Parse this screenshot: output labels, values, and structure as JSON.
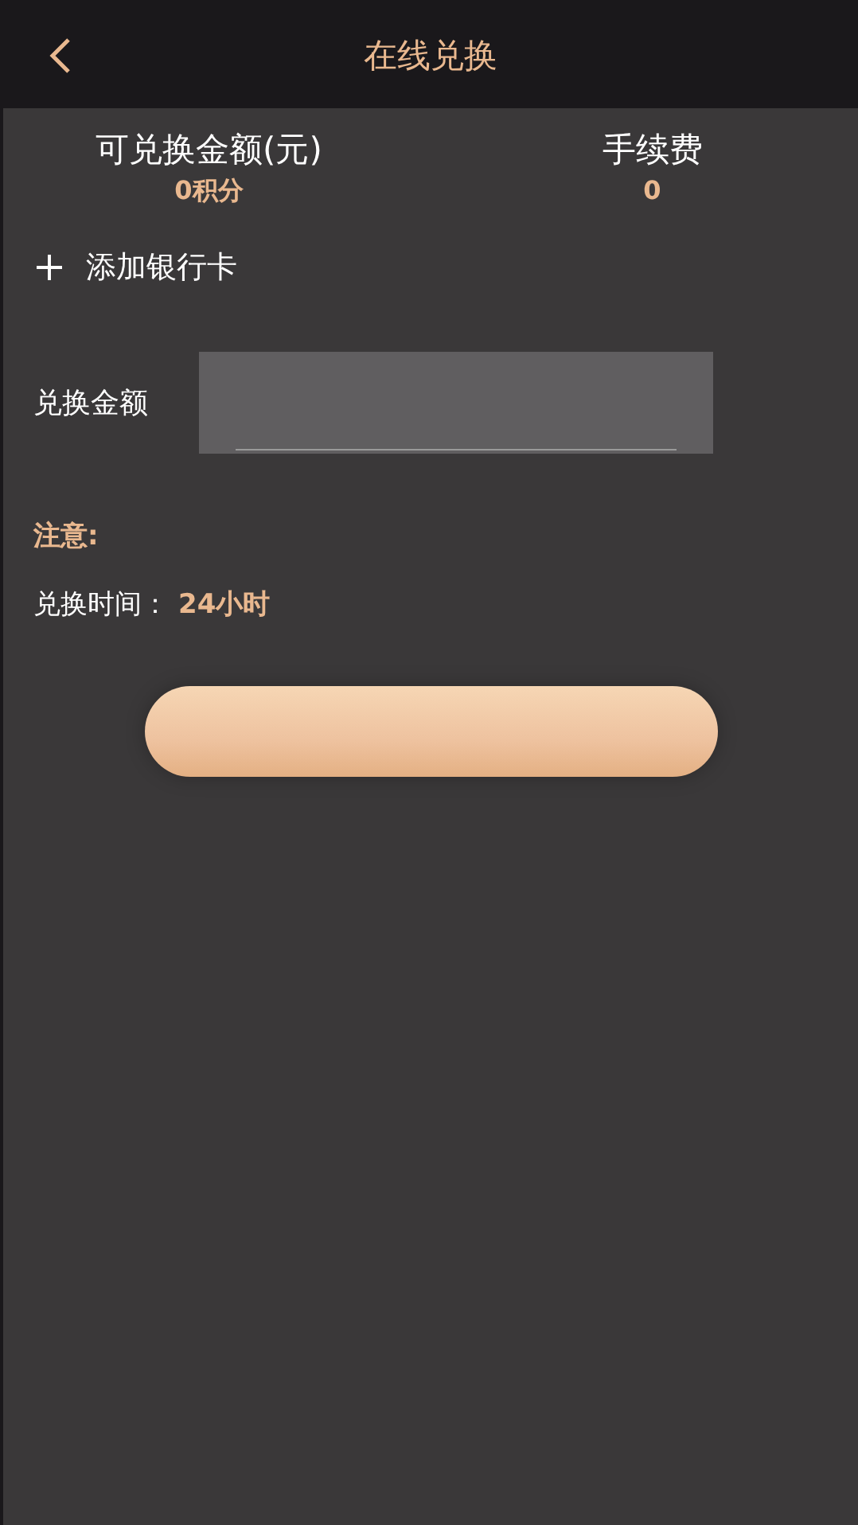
{
  "header": {
    "title": "在线兑换"
  },
  "summary": [
    {
      "label": "可兑换金额(元)",
      "value": "0积分"
    },
    {
      "label": "手续费",
      "value": "0"
    }
  ],
  "add_card": {
    "label": "添加银行卡"
  },
  "amount": {
    "label": "兑换金额"
  },
  "notice": {
    "title": "注意:",
    "time_label": "兑换时间：",
    "time_value": "24小时"
  }
}
